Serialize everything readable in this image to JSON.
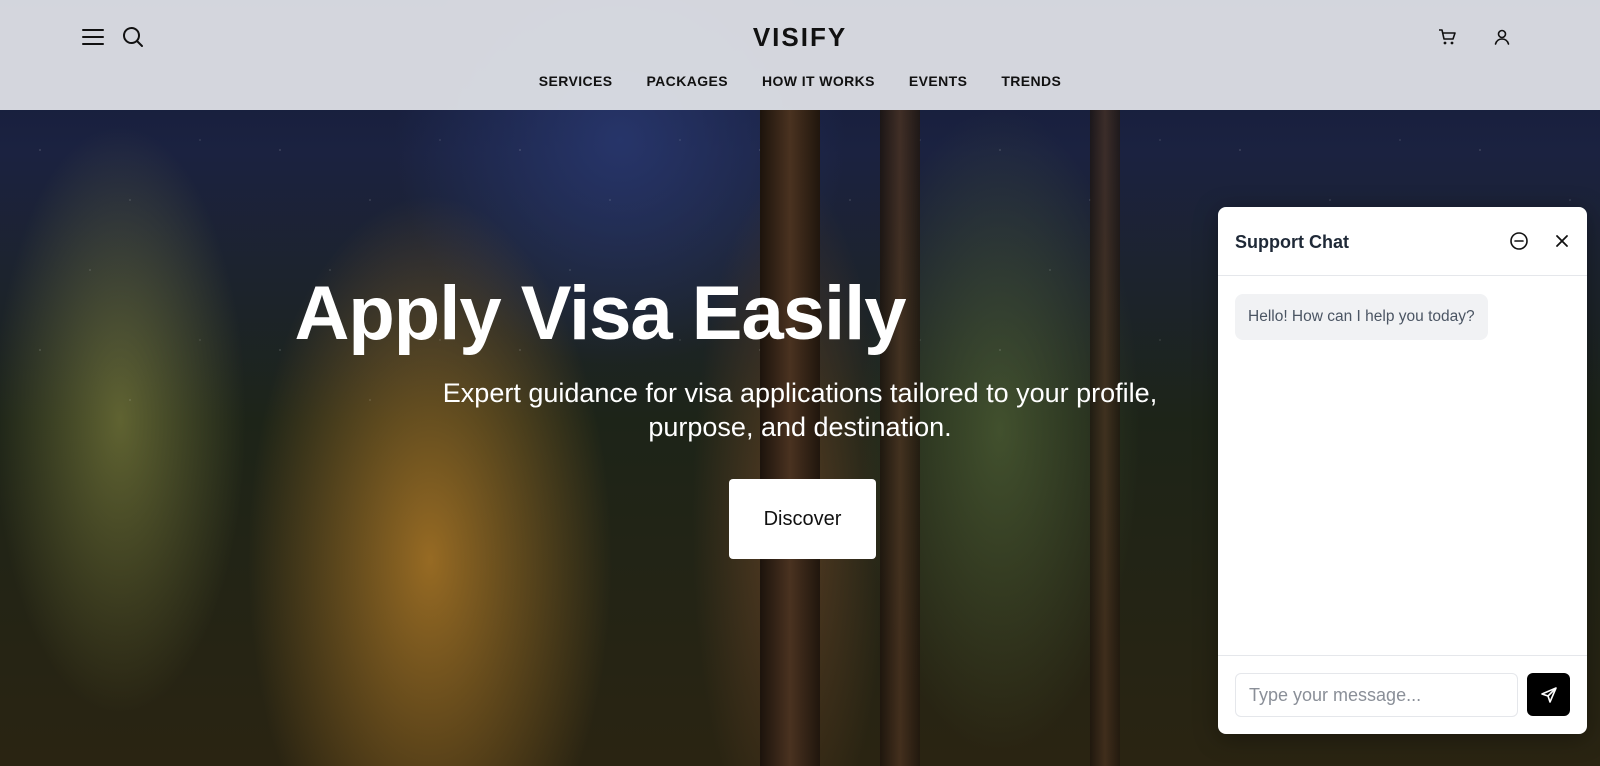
{
  "header": {
    "logo": "VISIFY",
    "menu_icon": "hamburger-menu-icon",
    "search_icon": "search-icon",
    "cart_icon": "shopping-cart-icon",
    "user_icon": "user-icon",
    "nav": [
      {
        "label": "SERVICES"
      },
      {
        "label": "PACKAGES"
      },
      {
        "label": "HOW IT WORKS"
      },
      {
        "label": "EVENTS"
      },
      {
        "label": "TRENDS"
      }
    ]
  },
  "hero": {
    "title": "Apply Visa Easily",
    "subtitle": "Expert guidance for visa applications tailored to your profile, purpose, and destination.",
    "cta_label": "Discover"
  },
  "chat": {
    "title": "Support Chat",
    "minimize_icon": "minus-circle-icon",
    "close_icon": "close-icon",
    "messages": [
      {
        "text": "Hello! How can I help you today?"
      }
    ],
    "input_placeholder": "Type your message...",
    "send_icon": "send-icon"
  },
  "colors": {
    "header_bg": "#dee0e6",
    "send_button": "#000000",
    "cta_bg": "#ffffff"
  }
}
